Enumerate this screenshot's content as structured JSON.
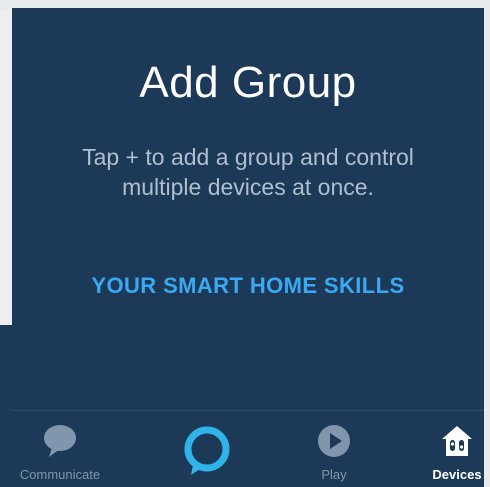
{
  "screen": {
    "title": "Add Group",
    "subtitle": "Tap + to add a group and control multiple devices at once.",
    "skills_link": "YOUR SMART HOME SKILLS"
  },
  "nav": {
    "items": [
      {
        "label": "Communicate",
        "icon": "chat-bubble-icon",
        "active": false
      },
      {
        "label": "",
        "icon": "alexa-ring-icon",
        "active": false
      },
      {
        "label": "Play",
        "icon": "play-icon",
        "active": false
      },
      {
        "label": "Devices",
        "icon": "smart-home-icon",
        "active": true
      }
    ]
  },
  "colors": {
    "background": "#1c3a57",
    "accent": "#3aa8f2",
    "alexa_ring": "#2fb4e9",
    "inactive": "#7f96ad"
  }
}
